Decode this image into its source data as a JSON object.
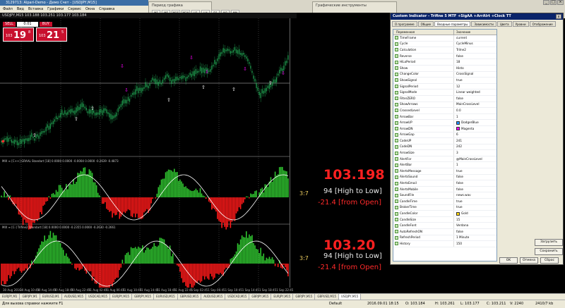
{
  "window": {
    "title": "3129713: Alpari-Demo - Демо Счет - [USDJPY,M15]"
  },
  "menu": [
    "Файл",
    "Вид",
    "Вставка",
    "Графики",
    "Сервис",
    "Окна",
    "Справка"
  ],
  "toolbar": {
    "period_label": "Период графика",
    "tools_label": "Графические инструменты",
    "timeframes": [
      "M1",
      "M5",
      "M15",
      "M30",
      "H1",
      "H4",
      "D1",
      "W1",
      "MN"
    ]
  },
  "chart": {
    "title": "USDJPY,M15  103.188 103.251 103.177 103.184",
    "trade": {
      "sell_label": "SELL",
      "buy_label": "BUY",
      "volume": "0.01",
      "sell_prefix": "103",
      "sell_big": "19",
      "sell_sup": "8",
      "buy_prefix": "103",
      "buy_big": "21",
      "buy_sup": "5"
    },
    "ind1_label": "MIX ≡ [C++] GRAAL Standart [18] 0.0000 0.0000 -0.0004 0.0000 -0.2639 -0.4873",
    "ind2_label": "MIX ≡ [C-] Trifine2 Standart [18] 0.0000 0.0000 -0.2355 0.0000 -0.2630 -0.2661",
    "panel1": {
      "price": "103.198",
      "hl": "94 [High to Low]",
      "open": "-21.4 [from Open]",
      "ratio": "3:7"
    },
    "panel2": {
      "price": "103.20",
      "hl": "94 [High to Low]",
      "open": "-21.4 [from Open]",
      "ratio": "3:7"
    },
    "dates": [
      "30 Aug 2016",
      "30 Aug 10:45",
      "30 Aug 14:45",
      "30 Aug 18:45",
      "30 Aug 22:45",
      "31 Aug 02:45",
      "31 Aug 06:45",
      "31 Aug 10:45",
      "31 Aug 14:45",
      "31 Aug 18:45",
      "31 Aug 22:45",
      "1 Sep 02:45",
      "1 Sep 06:45",
      "1 Sep 10:45",
      "1 Sep 14:45",
      "1 Sep 18:45",
      "1 Sep 22:45"
    ]
  },
  "tabs": [
    "EURJPY,M1",
    "GBPJPY,M1",
    "EURUSD,M1",
    "AUDUSD,M15",
    "USDCAD,M15",
    "EURJPY,M15",
    "GBPJPY,M15",
    "EURUSD,M15",
    "GBPUSD,M15",
    "AUDUSD,M15",
    "USDCAD,M15",
    "GBPJPY,M15",
    "EURJPY,M15",
    "GBPJPY,M15",
    "GBPUSD,M15",
    "USDJPY,M15"
  ],
  "status": {
    "help": "Для вызова справки нажмите F1",
    "profile": "Default",
    "datetime": "2016.09.01 18:15",
    "open": "O: 103.184",
    "high": "H: 103.261",
    "low": "L: 103.177",
    "close": "C: 103.211",
    "volume": "V: 2240",
    "traffic": "2410/7 kb"
  },
  "dialog": {
    "title": "Custom Indicator - Trifine 5 MTF +SigAA +ArrAlrt +Clock TT",
    "close": "x",
    "tabs": [
      "О программе",
      "Общие",
      "Входные параметры",
      "Зависимости",
      "Цвета",
      "Уровни",
      "Отображение"
    ],
    "col_name": "Переменная",
    "col_value": "Значение",
    "params": [
      {
        "name": "TimeFrame",
        "value": "current"
      },
      {
        "name": "Cycle",
        "value": "CycleMinus"
      },
      {
        "name": "Calculation",
        "value": "Trilne2"
      },
      {
        "name": "Reverse",
        "value": "false"
      },
      {
        "name": "HiLoPeriod",
        "value": "18"
      },
      {
        "name": "Show",
        "value": "Histo"
      },
      {
        "name": "ChangeColor",
        "value": "CrossSignal"
      },
      {
        "name": "ShowSignal",
        "value": "true"
      },
      {
        "name": "SignalPeriod",
        "value": "12"
      },
      {
        "name": "SignalMode",
        "value": "Linear weighted"
      },
      {
        "name": "FilterZERO",
        "value": "false"
      },
      {
        "name": "ShowArrows",
        "value": "MainCrossLevel"
      },
      {
        "name": "CrossedLevel",
        "value": "0.0"
      },
      {
        "name": "ArrowBar",
        "value": "1"
      },
      {
        "name": "ArrowUP",
        "value": "DodgerBlue",
        "swatch": "#1e90ff"
      },
      {
        "name": "ArrowDN",
        "value": "Magenta",
        "swatch": "#ff00ff"
      },
      {
        "name": "ArrowGap",
        "value": "6"
      },
      {
        "name": "CodeUP",
        "value": "241"
      },
      {
        "name": "CodeDN",
        "value": "242"
      },
      {
        "name": "ArrowSize",
        "value": "3"
      },
      {
        "name": "AlertFor",
        "value": "@MainCrossLevel"
      },
      {
        "name": "AlertBar",
        "value": "1"
      },
      {
        "name": "AlertsMessage",
        "value": "true"
      },
      {
        "name": "AlertsSound",
        "value": "false"
      },
      {
        "name": "AlertsEmail",
        "value": "false"
      },
      {
        "name": "AlertsMobile",
        "value": "false"
      },
      {
        "name": "SoundFile",
        "value": "news.wav"
      },
      {
        "name": "CandleTime",
        "value": "true"
      },
      {
        "name": "BrokerTime",
        "value": "true"
      },
      {
        "name": "CandleColor",
        "value": "Gold",
        "swatch": "#ffd700"
      },
      {
        "name": "CandleSize",
        "value": "15"
      },
      {
        "name": "CandleFont",
        "value": "Verdana"
      },
      {
        "name": "AutoRefreshON",
        "value": "false"
      },
      {
        "name": "RefreshPeriod",
        "value": "1 Minute"
      },
      {
        "name": "History",
        "value": "150"
      }
    ],
    "load_button": "Загрузить",
    "save_button": "Сохранить",
    "ok_button": "OK",
    "cancel_button": "Отмена",
    "reset_button": "Сброс"
  },
  "colors": {
    "bull_histo": "#2fc32f",
    "bear_histo": "#ff1a1a",
    "candle": "#22aa55",
    "arrow_up": "#ffffff",
    "arrow_dn": "#ff00ff",
    "signal_line": "#ffffff"
  }
}
